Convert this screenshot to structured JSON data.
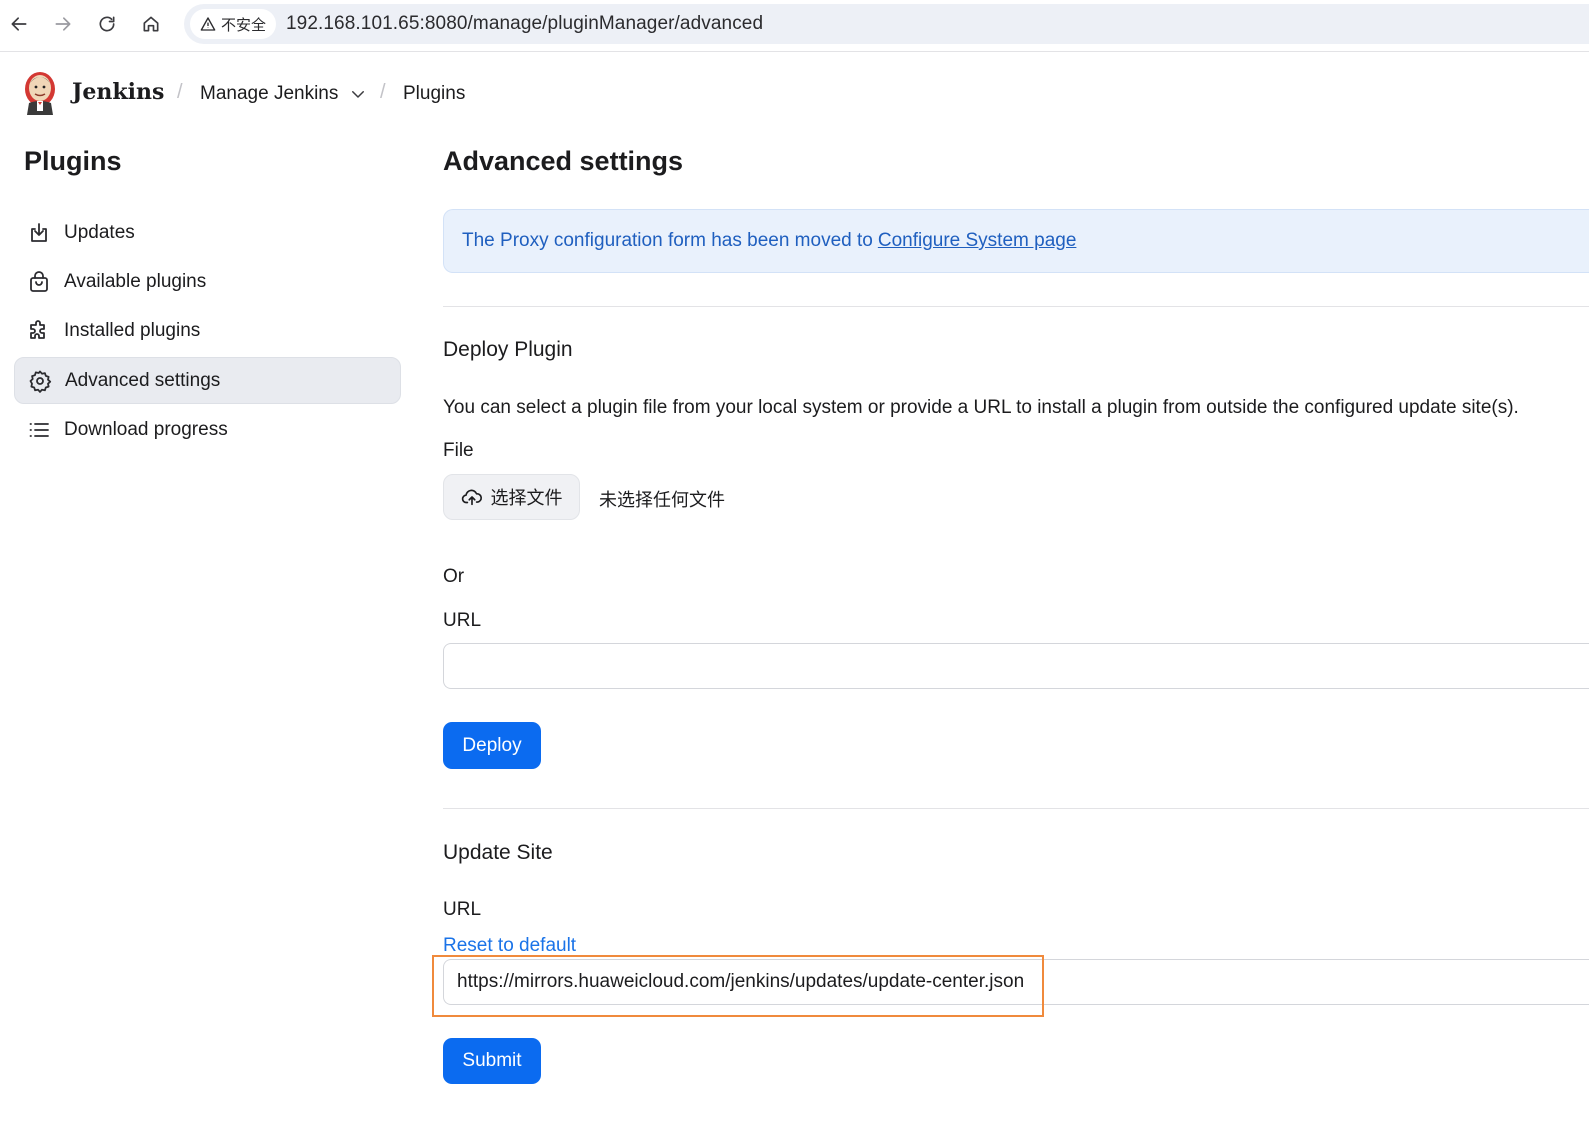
{
  "browser": {
    "security_label": "不安全",
    "url": "192.168.101.65:8080/manage/pluginManager/advanced"
  },
  "header": {
    "brand": "Jenkins",
    "breadcrumbs": [
      "Manage Jenkins",
      "Plugins"
    ],
    "separator": "/"
  },
  "sidebar": {
    "title": "Plugins",
    "items": [
      {
        "label": "Updates",
        "icon": "download-icon",
        "active": false
      },
      {
        "label": "Available plugins",
        "icon": "shopping-bag-icon",
        "active": false
      },
      {
        "label": "Installed plugins",
        "icon": "puzzle-icon",
        "active": false
      },
      {
        "label": "Advanced settings",
        "icon": "gear-icon",
        "active": true
      },
      {
        "label": "Download progress",
        "icon": "list-icon",
        "active": false
      }
    ]
  },
  "main": {
    "title": "Advanced settings",
    "notice": {
      "text": "The Proxy configuration form has been moved to",
      "link": "Configure System page"
    },
    "deploy": {
      "title": "Deploy Plugin",
      "description": "You can select a plugin file from your local system or provide a URL to install a plugin from outside the configured update site(s).",
      "file_label": "File",
      "choose_file_label": "选择文件",
      "no_file_label": "未选择任何文件",
      "or_label": "Or",
      "url_label": "URL",
      "url_value": "",
      "button_label": "Deploy"
    },
    "update_site": {
      "title": "Update Site",
      "url_label": "URL",
      "reset_label": "Reset to default",
      "url_value": "https://mirrors.huaweicloud.com/jenkins/updates/update-center.json",
      "button_label": "Submit"
    }
  },
  "colors": {
    "primary": "#0b6bf0",
    "notice_bg": "#e9f1fc",
    "notice_text": "#1f5fbf",
    "highlight": "#f08a3c"
  }
}
